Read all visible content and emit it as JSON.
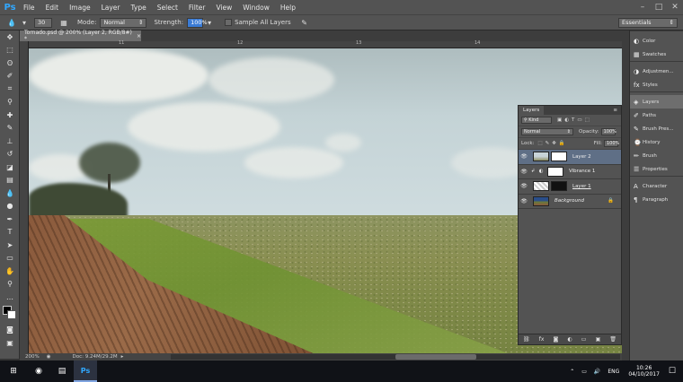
{
  "app": {
    "logo": "Ps",
    "menu": [
      "File",
      "Edit",
      "Image",
      "Layer",
      "Type",
      "Select",
      "Filter",
      "View",
      "Window",
      "Help"
    ]
  },
  "options": {
    "brush_size": "30",
    "mode_label": "Mode:",
    "mode_value": "Normal",
    "strength_label": "Strength:",
    "strength_value": "100%",
    "sample_all_layers": "Sample All Layers",
    "workspace": "Essentials"
  },
  "document": {
    "tab_title": "Tornado.psd @ 200% (Layer 2, RGB/8#) *",
    "ruler_ticks": [
      "11",
      "12",
      "13",
      "14"
    ],
    "zoom": "200%",
    "doc_info": "Doc: 9.24M/29.2M"
  },
  "right_panels": {
    "items": [
      "Color",
      "Swatches",
      "Adjustmen...",
      "Styles",
      "Layers",
      "Paths",
      "Brush Pres...",
      "History",
      "Brush",
      "Properties",
      "Character",
      "Paragraph"
    ]
  },
  "layers_panel": {
    "tab": "Layers",
    "filter_kind": "Kind",
    "blend_mode": "Normal",
    "opacity_label": "Opacity:",
    "opacity_value": "100%",
    "lock_label": "Lock:",
    "fill_label": "Fill:",
    "fill_value": "100%",
    "layers": [
      {
        "name": "Layer 2",
        "selected": true
      },
      {
        "name": "Vibrance 1",
        "selected": false
      },
      {
        "name": "Layer 1",
        "selected": false
      },
      {
        "name": "Background",
        "selected": false
      }
    ]
  },
  "taskbar": {
    "language": "ENG",
    "time": "10:26",
    "date": "04/10/2017"
  },
  "colors": {
    "selection": "#5f6f86",
    "ps_blue": "#31a8ff"
  }
}
